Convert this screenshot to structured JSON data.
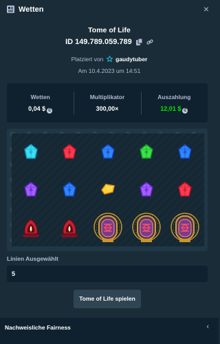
{
  "header": {
    "title": "Wetten",
    "close_symbol": "×"
  },
  "bet": {
    "game": "Tome of Life",
    "id": "ID 149.789.059.789",
    "placed_by_prefix": "Platziert von",
    "user": "gaudytuber",
    "date": "Am 10.4.2023 um 14:51"
  },
  "stats": {
    "wager_label": "Wetten",
    "wager_value": "0,04 $",
    "multiplier_label": "Multiplikator",
    "multiplier_value": "300,00×",
    "payout_label": "Auszahlung",
    "payout_value": "12,01 $"
  },
  "reels": [
    [
      "gem-cyan",
      "gem-red",
      "gem-blue",
      "gem-green",
      "gem-blue"
    ],
    [
      "gem-purple",
      "gem-blue",
      "gem-yellow",
      "gem-purple",
      "gem-red"
    ],
    [
      "flame-altar",
      "flame-altar",
      "tome-portal",
      "tome-portal",
      "tome-portal"
    ]
  ],
  "colors": {
    "win": "#00e701",
    "accent_star": "#1fb9d6"
  },
  "lines": {
    "label": "Linien Ausgewählt",
    "value": "5"
  },
  "play_button": "Tome of Life spielen",
  "fairness": {
    "label": "Nachweisliche Fairness",
    "chevron": "‹"
  }
}
